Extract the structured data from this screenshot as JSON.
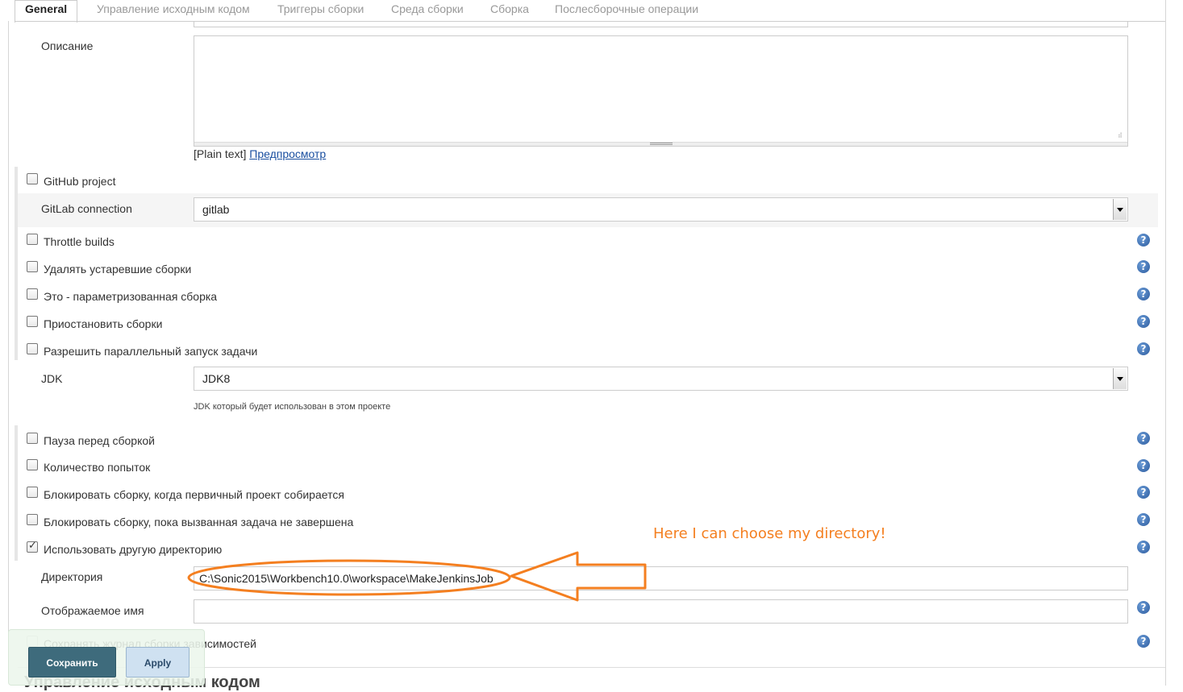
{
  "tabs": [
    "General",
    "Управление исходным кодом",
    "Триггеры сборки",
    "Среда сборки",
    "Сборка",
    "Послесборочные операции"
  ],
  "description": {
    "label": "Описание",
    "value": "",
    "format_text": "[Plain text]",
    "preview_link": "Предпросмотр"
  },
  "options_group1": {
    "github_project": "GitHub project",
    "gitlab_label": "GitLab connection",
    "gitlab_value": "gitlab",
    "throttle_builds": "Throttle builds",
    "discard_old": "Удалять устаревшие сборки",
    "parameterized": "Это - параметризованная сборка",
    "disable_builds": "Приостановить сборки",
    "concurrent": "Разрешить параллельный запуск задачи"
  },
  "jdk": {
    "label": "JDK",
    "value": "JDK8",
    "hint": "JDK который будет использован в этом проекте"
  },
  "options_group2": {
    "quiet_period": "Пауза перед сборкой",
    "retry_count": "Количество попыток",
    "block_upstream": "Блокировать сборку, когда первичный проект собирается",
    "block_downstream": "Блокировать сборку, пока вызванная задача не завершена",
    "custom_workspace": "Использовать другую директорию",
    "custom_workspace_checked": true
  },
  "workspace": {
    "dir_label": "Директория",
    "dir_value": "C:\\Sonic2015\\Workbench10.0\\workspace\\MakeJenkinsJob",
    "display_name_label": "Отображаемое имя",
    "display_name_value": "",
    "keep_log": "Сохранять журнал сборки зависимостей"
  },
  "annotation": "Here I can choose my directory!",
  "next_section": "Управление исходным кодом",
  "buttons": {
    "save": "Сохранить",
    "apply": "Apply"
  },
  "colors": {
    "annotation": "#f47f20",
    "save_bg": "#3e6b7c",
    "apply_bg": "#cfe1f1",
    "help": "#2d5c9f"
  },
  "icons": [
    "help-icon",
    "checkbox",
    "select-arrow-icon",
    "resize-grip-icon"
  ]
}
